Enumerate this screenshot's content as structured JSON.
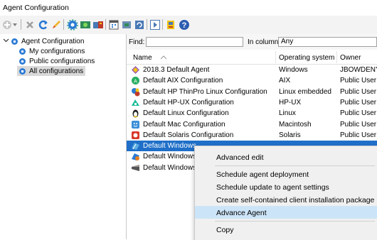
{
  "window": {
    "title": "Agent Configuration"
  },
  "toolbar": {
    "icons": [
      "add-dropdown-icon",
      "delete-icon",
      "refresh-icon",
      "edit-icon",
      "settings-icon",
      "image-icon",
      "deploy-icon",
      "schedule-icon",
      "package-icon",
      "update-icon",
      "run-icon",
      "export-icon",
      "help-icon"
    ]
  },
  "tree": {
    "root": "Agent Configuration",
    "items": [
      "My configurations",
      "Public configurations",
      "All configurations"
    ],
    "selected": "All configurations"
  },
  "find": {
    "label": "Find:",
    "value": "",
    "column_label": "In column:",
    "column_value": "Any"
  },
  "table": {
    "columns": [
      "Name",
      "Operating system",
      "Owner"
    ],
    "rows": [
      {
        "name": "2018.3 Default Agent",
        "os": "Windows",
        "owner": "JBOWDENY"
      },
      {
        "name": "Default AIX Configuration",
        "os": "AIX",
        "owner": "Public User"
      },
      {
        "name": "Default HP ThinPro Linux Configuration",
        "os": "Linux embedded",
        "owner": "Public User"
      },
      {
        "name": "Default HP-UX Configuration",
        "os": "HP-UX",
        "owner": "Public User"
      },
      {
        "name": "Default Linux Configuration",
        "os": "Linux",
        "owner": "Public User"
      },
      {
        "name": "Default Mac Configuration",
        "os": "Macintosh",
        "owner": "Public User"
      },
      {
        "name": "Default Solaris Configuration",
        "os": "Solaris",
        "owner": "Public User"
      },
      {
        "name": "Default Windows",
        "os": "",
        "owner": ""
      },
      {
        "name": "Default Windows",
        "os": "",
        "owner": ""
      },
      {
        "name": "Default Windows",
        "os": "",
        "owner": ""
      }
    ],
    "selected_row": 7
  },
  "context_menu": {
    "items": [
      "Advanced edit",
      "Schedule agent deployment",
      "Schedule update to agent settings",
      "Create self-contained client installation package",
      "Advance Agent",
      "Copy"
    ],
    "highlighted": "Advance Agent"
  },
  "colors": {
    "selection": "#1f6fc8",
    "menu_highlight": "#cce4f7",
    "tree_selected": "#d9d9d9"
  }
}
